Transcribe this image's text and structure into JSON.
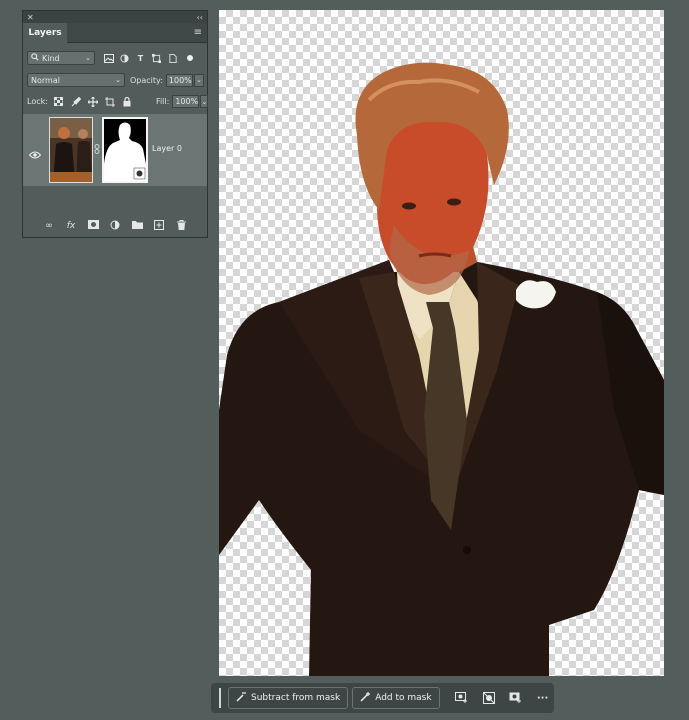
{
  "panel": {
    "title": "Layers",
    "collapse_glyph": "‹‹",
    "close_glyph": "✕",
    "filter": {
      "label": "Kind",
      "icons": [
        "image-filter-icon",
        "adjustment-filter-icon",
        "type-filter-icon",
        "shape-filter-icon",
        "smart-object-filter-icon"
      ]
    },
    "blend_mode": "Normal",
    "opacity_label": "Opacity:",
    "opacity_value": "100%",
    "lock_label": "Lock:",
    "fill_label": "Fill:",
    "fill_value": "100%",
    "layers": [
      {
        "name": "Layer 0",
        "visible": true,
        "has_mask": true
      }
    ],
    "footer_icons": [
      "link-icon",
      "fx-icon",
      "add-mask-icon",
      "adjustment-icon",
      "folder-icon",
      "new-layer-icon",
      "trash-icon"
    ]
  },
  "taskbar": {
    "subtract_label": "Subtract from mask",
    "add_label": "Add to mask",
    "more_glyph": "···"
  },
  "colors": {
    "workspace": "#535e5c",
    "panel": "#525c5a",
    "selected_layer": "#6b7573",
    "taskbar": "#3d4645"
  }
}
